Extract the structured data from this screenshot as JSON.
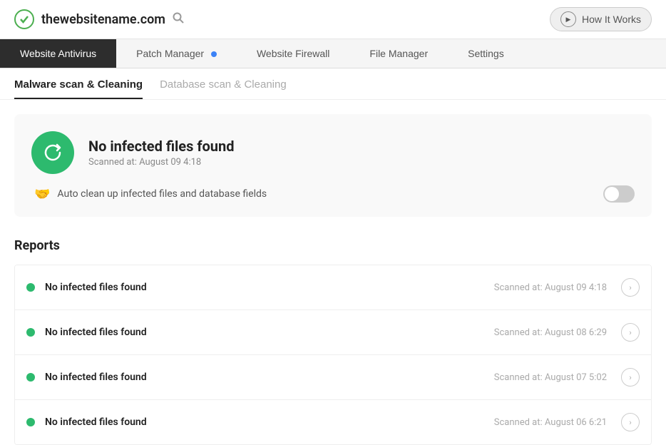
{
  "header": {
    "site_name": "thewebsitename.com",
    "search_icon": "search",
    "how_it_works_label": "How It Works",
    "play_icon": "▶"
  },
  "nav": {
    "tabs": [
      {
        "id": "website-antivirus",
        "label": "Website Antivirus",
        "active": true,
        "dot": false
      },
      {
        "id": "patch-manager",
        "label": "Patch Manager",
        "active": false,
        "dot": true
      },
      {
        "id": "website-firewall",
        "label": "Website Firewall",
        "active": false,
        "dot": false
      },
      {
        "id": "file-manager",
        "label": "File Manager",
        "active": false,
        "dot": false
      },
      {
        "id": "settings",
        "label": "Settings",
        "active": false,
        "dot": false
      }
    ]
  },
  "sub_tabs": [
    {
      "id": "malware-scan",
      "label": "Malware scan & Cleaning",
      "active": true
    },
    {
      "id": "database-scan",
      "label": "Database scan & Cleaning",
      "active": false
    }
  ],
  "status_card": {
    "title": "No infected files found",
    "scanned_at": "Scanned at: August 09 4:18",
    "auto_clean_label": "Auto clean up infected files and database fields",
    "auto_clean_enabled": false
  },
  "reports": {
    "title": "Reports",
    "items": [
      {
        "label": "No infected files found",
        "scanned_at": "Scanned at: August 09 4:18"
      },
      {
        "label": "No infected files found",
        "scanned_at": "Scanned at: August 08 6:29"
      },
      {
        "label": "No infected files found",
        "scanned_at": "Scanned at: August 07 5:02"
      },
      {
        "label": "No infected files found",
        "scanned_at": "Scanned at: August 06 6:21"
      }
    ]
  }
}
